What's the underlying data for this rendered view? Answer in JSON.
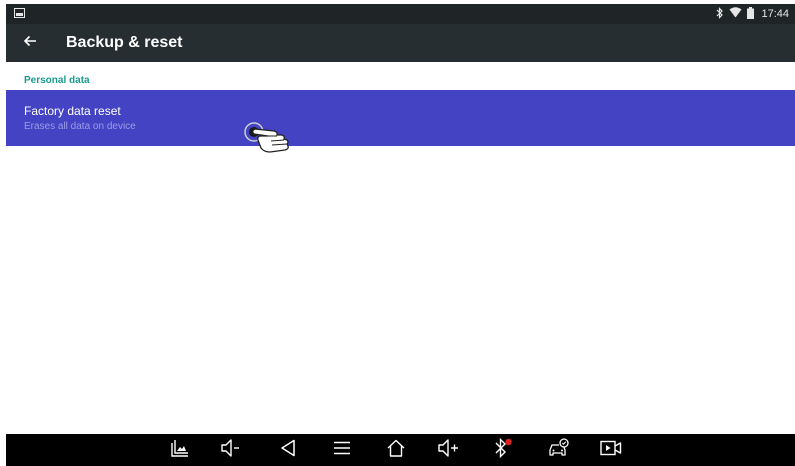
{
  "status_bar": {
    "notification_icon": "image-notification-icon",
    "icons": [
      "bluetooth-icon",
      "wifi-icon",
      "battery-icon"
    ],
    "time": "17:44"
  },
  "app_bar": {
    "back_icon": "arrow-back-icon",
    "title": "Backup & reset"
  },
  "content": {
    "section_header": "Personal data",
    "items": [
      {
        "title": "Factory data reset",
        "subtitle": "Erases all data on device",
        "selected": true
      }
    ]
  },
  "nav_bar": {
    "buttons": [
      "screenshot",
      "volume-down",
      "back",
      "menu",
      "home",
      "volume-up",
      "bluetooth",
      "vehicle-diagnostics",
      "screen-record"
    ]
  },
  "colors": {
    "status_bar_bg": "#1f2527",
    "app_bar_bg": "#262e31",
    "accent": "#1b9b8f",
    "selected_item_bg": "#4443c4",
    "nav_bar_bg": "#000000"
  }
}
